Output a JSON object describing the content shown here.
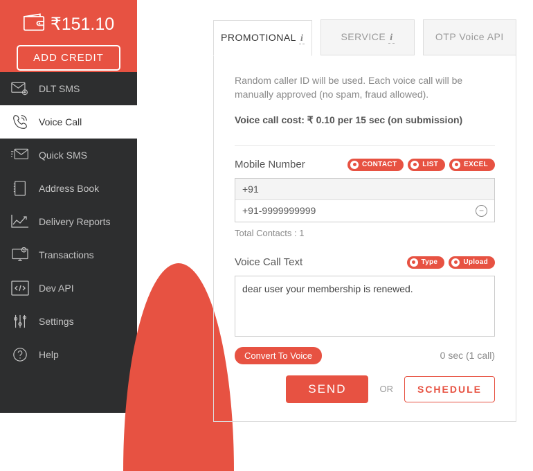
{
  "header": {
    "balance": "₹151.10",
    "add_credit": "ADD CREDIT"
  },
  "sidebar": {
    "items": [
      {
        "label": "DLT SMS"
      },
      {
        "label": "Voice Call"
      },
      {
        "label": "Quick SMS"
      },
      {
        "label": "Address Book"
      },
      {
        "label": "Delivery Reports"
      },
      {
        "label": "Transactions"
      },
      {
        "label": "Dev API"
      },
      {
        "label": "Settings"
      },
      {
        "label": "Help"
      }
    ]
  },
  "tabs": {
    "promotional": "PROMOTIONAL",
    "service": "SERVICE",
    "otp": "OTP Voice API",
    "info": "i"
  },
  "panel": {
    "desc": "Random caller ID will be used. Each voice call will be manually approved (no spam, fraud allowed).",
    "cost": "Voice call cost: ₹ 0.10 per 15 sec (on submission)"
  },
  "mobile": {
    "label": "Mobile Number",
    "pills": {
      "contact": "CONTACT",
      "list": "LIST",
      "excel": "EXCEL"
    },
    "prefix": "+91",
    "contact": "+91-9999999999",
    "total": "Total Contacts : 1"
  },
  "voice": {
    "label": "Voice Call Text",
    "pills": {
      "type": "Type",
      "upload": "Upload"
    },
    "text": "dear user your membership is renewed.",
    "convert": "Convert To Voice",
    "meta": "0 sec (1 call)"
  },
  "actions": {
    "send": "SEND",
    "or": "OR",
    "schedule": "SCHEDULE"
  }
}
